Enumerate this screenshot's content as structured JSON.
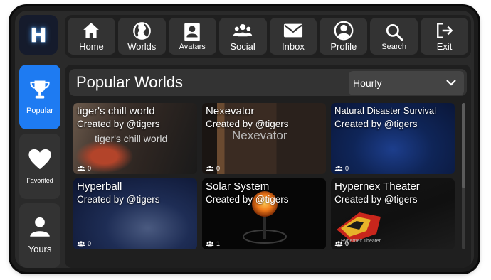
{
  "logo": {
    "letter": "H"
  },
  "nav": [
    {
      "label": "Home",
      "icon": "home-icon"
    },
    {
      "label": "Worlds",
      "icon": "globe-icon"
    },
    {
      "label": "Avatars",
      "icon": "id-card-icon"
    },
    {
      "label": "Social",
      "icon": "people-icon"
    },
    {
      "label": "Inbox",
      "icon": "mail-icon"
    },
    {
      "label": "Profile",
      "icon": "user-circle-icon"
    },
    {
      "label": "Search",
      "icon": "search-icon"
    },
    {
      "label": "Exit",
      "icon": "exit-icon"
    }
  ],
  "sidebar": [
    {
      "label": "Popular",
      "icon": "trophy-icon",
      "active": true
    },
    {
      "label": "Favorited",
      "icon": "heart-icon",
      "active": false
    },
    {
      "label": "Yours",
      "icon": "person-icon",
      "active": false
    }
  ],
  "main": {
    "title": "Popular Worlds",
    "sort": {
      "value": "Hourly"
    }
  },
  "worlds": [
    {
      "title": "tiger's chill world",
      "creator": "Created by @tigers",
      "players": "0",
      "thumb_text": "tiger's chill world"
    },
    {
      "title": "Nexevator",
      "creator": "Created by @tigers",
      "players": "0",
      "thumb_text": "Nexevator"
    },
    {
      "title": "Natural Disaster Survival",
      "creator": "Created by @tigers",
      "players": "0"
    },
    {
      "title": "Hyperball",
      "creator": "Created by @tigers",
      "players": "0"
    },
    {
      "title": "Solar System",
      "creator": "Created by @tigers",
      "players": "1"
    },
    {
      "title": "Hypernex Theater",
      "creator": "Created by @tigers",
      "players": "0",
      "thumb_text": "Hypernex Theater"
    }
  ],
  "colors": {
    "accent": "#1e7bf2",
    "background": "#2a2a2a",
    "button": "#333333"
  }
}
